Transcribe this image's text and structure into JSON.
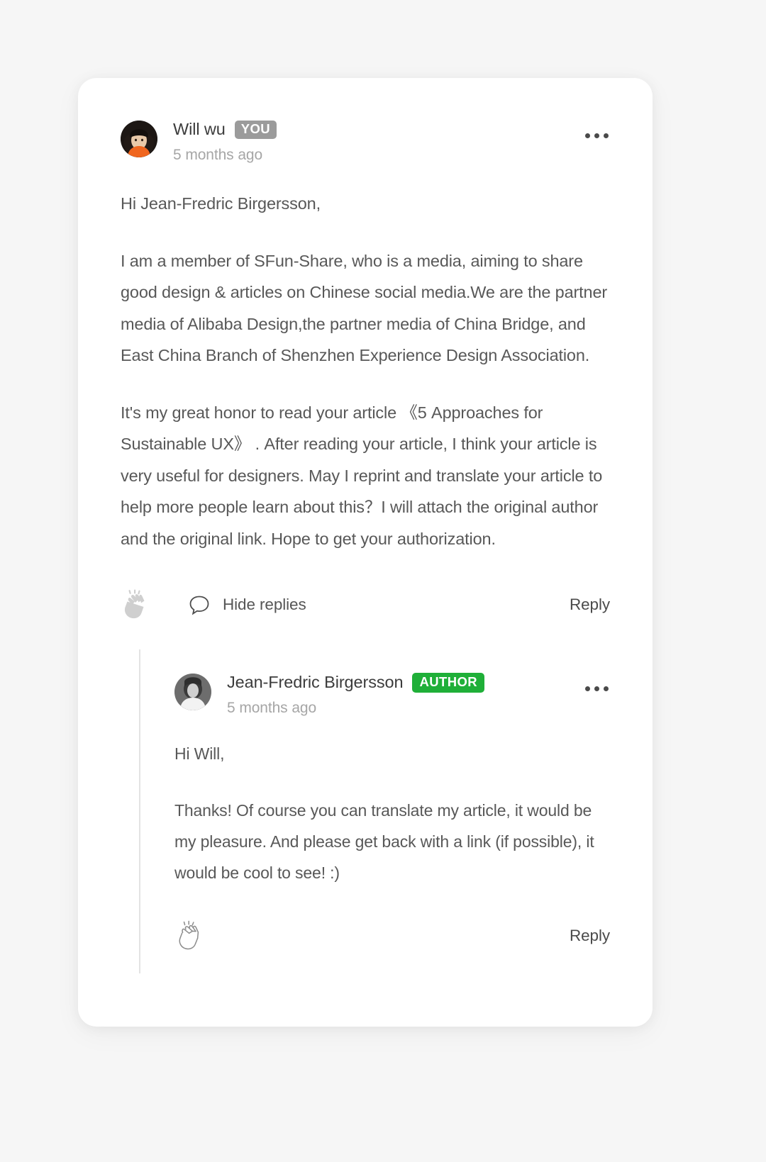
{
  "thread": {
    "root_comment": {
      "author_name": "Will wu",
      "badge": "YOU",
      "timestamp": "5 months ago",
      "avatar_alt": "will-wu-avatar",
      "more_menu_label": "More options",
      "paragraphs": [
        "Hi Jean-Fredric Birgersson,",
        "I am a member of SFun-Share, who is a media, aiming to share good design & articles on Chinese social media.We are the partner media of Alibaba Design,the partner media of China Bridge,  and East China Branch of Shenzhen Experience Design Association.",
        "It's my great honor to read your article 《5 Approaches for Sustainable UX》 . After reading your article, I think your article is very useful for designers. May I reprint and translate your article to help more people learn about this？I will attach the original author and the original link. Hope to get your authorization."
      ],
      "actions": {
        "clap_label": "Clap",
        "replies_toggle_label": "Hide replies",
        "reply_label": "Reply"
      }
    },
    "replies": [
      {
        "author_name": "Jean-Fredric Birgersson",
        "badge": "AUTHOR",
        "timestamp": "5 months ago",
        "avatar_alt": "jean-fredric-birgersson-avatar",
        "more_menu_label": "More options",
        "paragraphs": [
          "Hi Will,",
          "Thanks! Of course you can translate my article, it would be my pleasure. And please get back with a link (if possible), it would be cool to see! :)"
        ],
        "actions": {
          "clap_label": "Clap",
          "reply_label": "Reply"
        }
      }
    ]
  },
  "colors": {
    "card_background": "#ffffff",
    "page_background": "#f6f6f6",
    "badge_you": "#9b9b9b",
    "badge_author": "#1faf38",
    "body_text": "#585858",
    "muted_text": "#a6a6a6",
    "thread_line": "#e3e3e3"
  }
}
